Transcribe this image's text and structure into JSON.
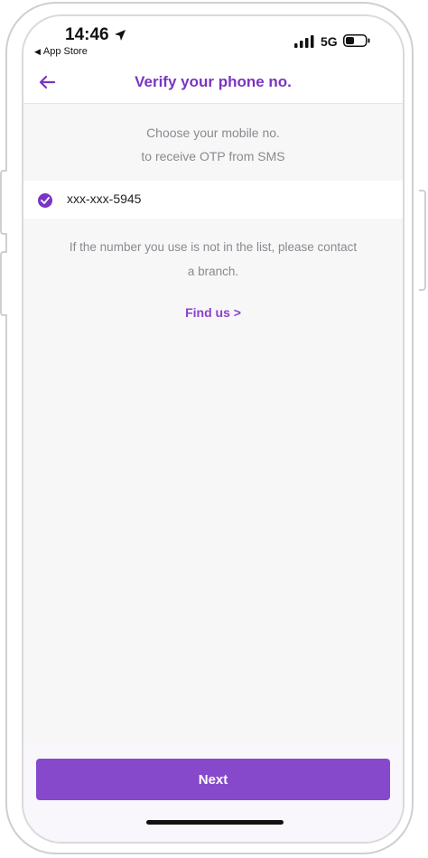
{
  "status_bar": {
    "time": "14:46",
    "back_app": "App Store",
    "network": "5G"
  },
  "header": {
    "title": "Verify your phone no."
  },
  "instructions": {
    "line1": "Choose your mobile no.",
    "line2": "to receive OTP from SMS"
  },
  "phone_option": {
    "number": "xxx-xxx-5945",
    "selected": true
  },
  "notice": {
    "line1": "If the number you use is not in the list, please contact",
    "line2": "a branch."
  },
  "find_us_label": "Find us >",
  "next_label": "Next",
  "colors": {
    "accent": "#7a35c2",
    "button": "#8649cc",
    "muted_text": "#8a8a90"
  },
  "icons": {
    "back": "arrow-left-icon",
    "check": "check-circle-icon",
    "location": "location-arrow-icon",
    "signal": "signal-bars-icon",
    "battery": "battery-icon"
  }
}
